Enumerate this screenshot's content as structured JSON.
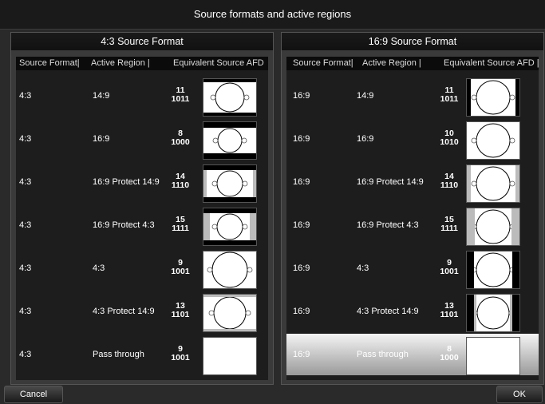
{
  "window_title": "Source formats and active regions",
  "columns": {
    "source_format": "Source Format|",
    "active_region": "Active Region  |",
    "equivalent_afd": "Equivalent Source AFD"
  },
  "columns_right": {
    "source_format": "Source Format|",
    "active_region": "Active Region  |",
    "equivalent_afd": "Equivalent Source AFD  |"
  },
  "left_panel": {
    "title": "4:3 Source Format",
    "rows": [
      {
        "source": "4:3",
        "region": "14:9",
        "afd_num": "11",
        "afd_bin": "1011",
        "thumb": "letterbox-14-9"
      },
      {
        "source": "4:3",
        "region": "16:9",
        "afd_num": "8",
        "afd_bin": "1000",
        "thumb": "letterbox-16-9"
      },
      {
        "source": "4:3",
        "region": "16:9 Protect 14:9",
        "afd_num": "14",
        "afd_bin": "1110",
        "thumb": "letterbox-protect-14-9"
      },
      {
        "source": "4:3",
        "region": "16:9 Protect 4:3",
        "afd_num": "15",
        "afd_bin": "1111",
        "thumb": "letterbox-protect-4-3"
      },
      {
        "source": "4:3",
        "region": "4:3",
        "afd_num": "9",
        "afd_bin": "1001",
        "thumb": "full-4-3"
      },
      {
        "source": "4:3",
        "region": "4:3 Protect 14:9",
        "afd_num": "13",
        "afd_bin": "1101",
        "thumb": "full-protect-14-9"
      },
      {
        "source": "4:3",
        "region": "Pass through",
        "afd_num": "9",
        "afd_bin": "1001",
        "thumb": "blank"
      }
    ]
  },
  "right_panel": {
    "title": "16:9 Source Format",
    "rows": [
      {
        "source": "16:9",
        "region": "14:9",
        "afd_num": "11",
        "afd_bin": "1011",
        "thumb": "pillar-14-9"
      },
      {
        "source": "16:9",
        "region": "16:9",
        "afd_num": "10",
        "afd_bin": "1010",
        "thumb": "wide-16-9"
      },
      {
        "source": "16:9",
        "region": "16:9 Protect 14:9",
        "afd_num": "14",
        "afd_bin": "1110",
        "thumb": "wide-protect-14-9"
      },
      {
        "source": "16:9",
        "region": "16:9 Protect 4:3",
        "afd_num": "15",
        "afd_bin": "1111",
        "thumb": "wide-protect-4-3"
      },
      {
        "source": "16:9",
        "region": "4:3",
        "afd_num": "9",
        "afd_bin": "1001",
        "thumb": "pillar-4-3"
      },
      {
        "source": "16:9",
        "region": "4:3 Protect 14:9",
        "afd_num": "13",
        "afd_bin": "1101",
        "thumb": "pillar-protect-14-9"
      },
      {
        "source": "16:9",
        "region": "Pass through",
        "afd_num": "8",
        "afd_bin": "1000",
        "thumb": "blank",
        "selected": true
      }
    ]
  },
  "buttons": {
    "cancel": "Cancel",
    "ok": "OK"
  }
}
